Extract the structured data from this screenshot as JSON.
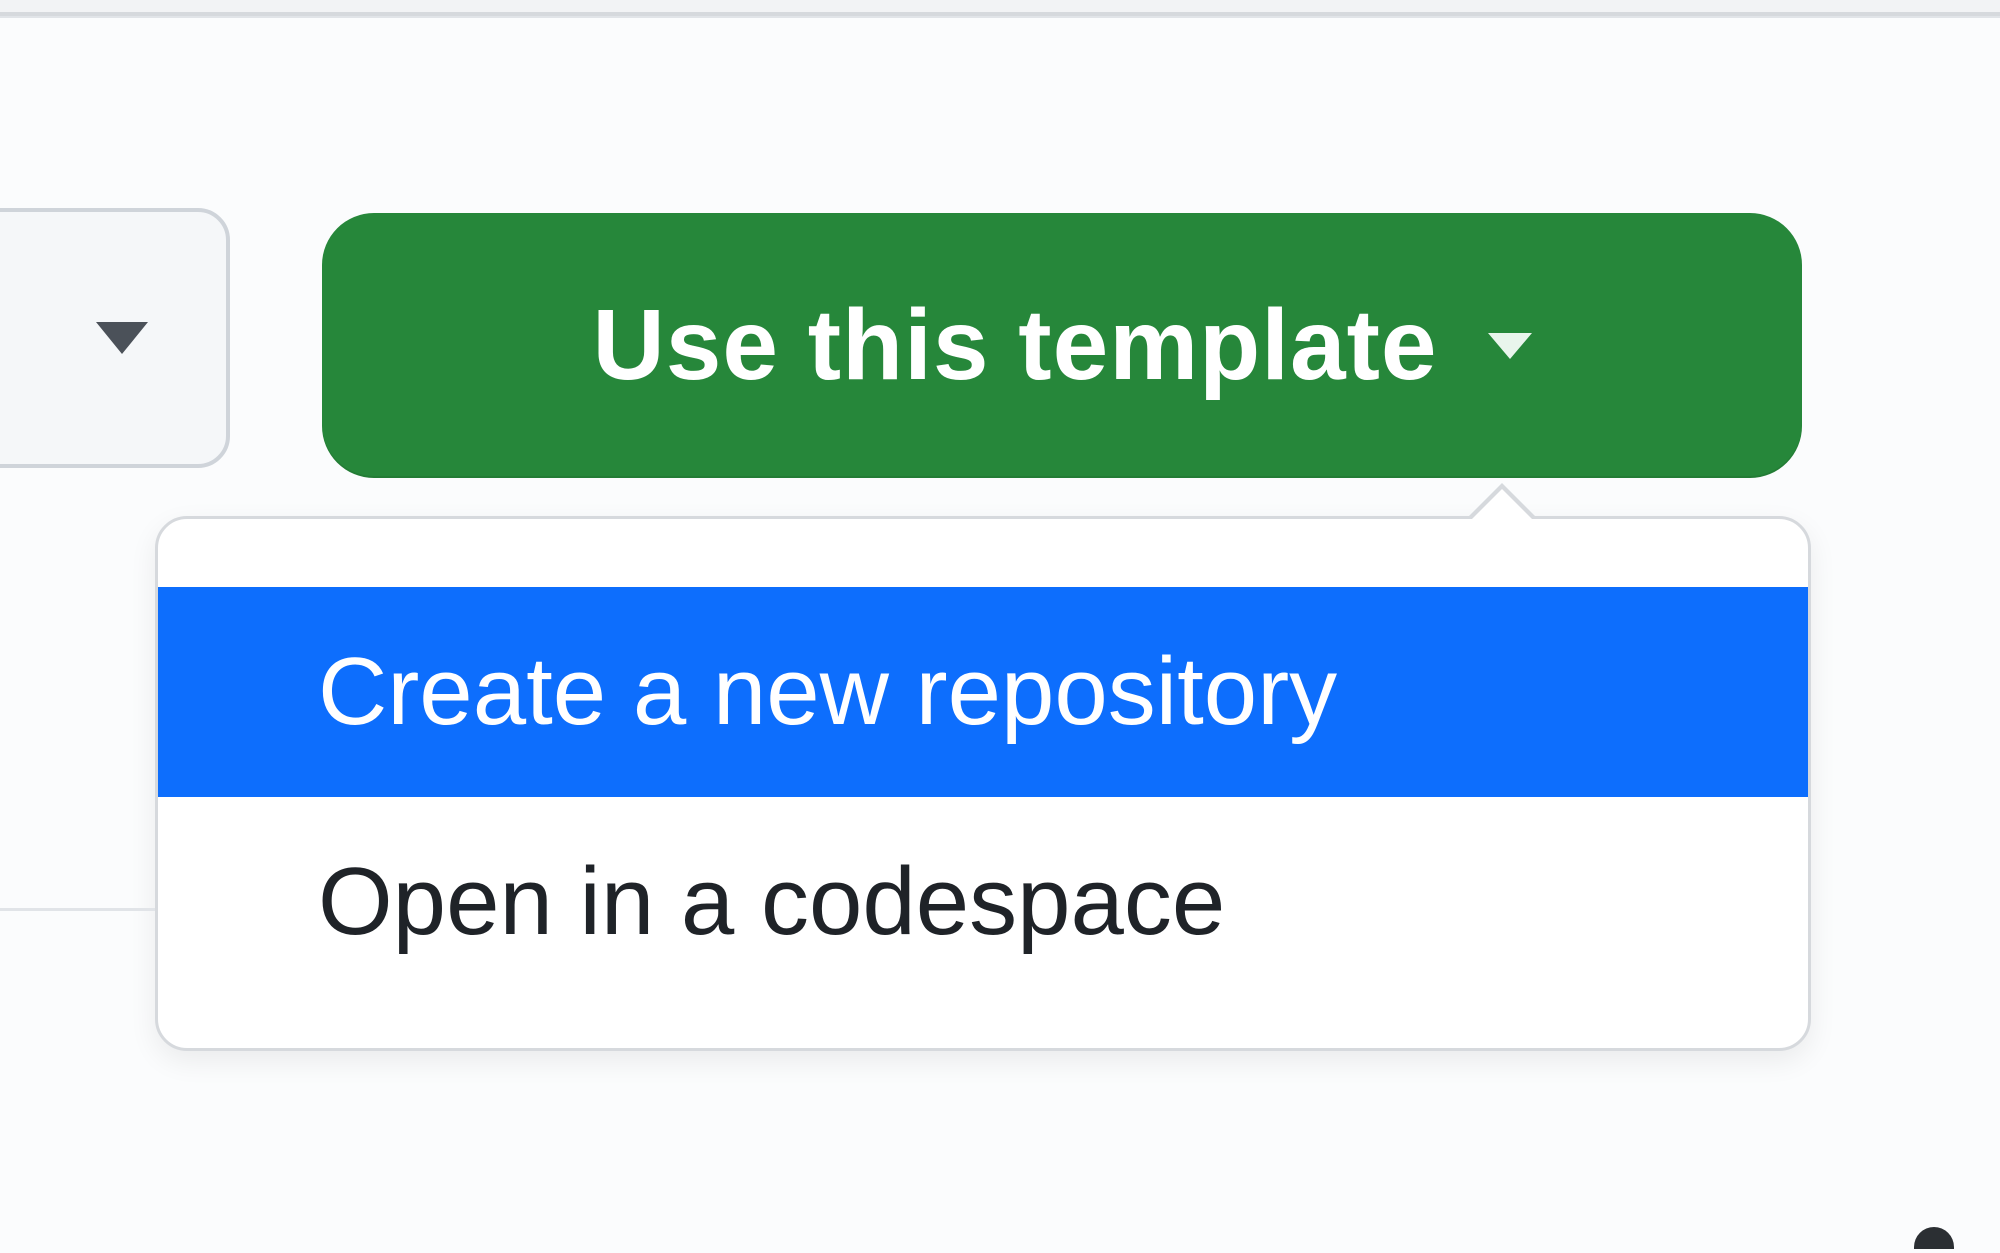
{
  "colors": {
    "primary_button_bg": "#26873a",
    "primary_button_text": "#ffffff",
    "menu_selected_bg": "#0d6efd",
    "menu_selected_text": "#ffffff",
    "menu_text": "#1f2328",
    "border": "#d6d9dd",
    "page_bg": "#fbfcfd"
  },
  "primary_button": {
    "label": "Use this template"
  },
  "dropdown": {
    "items": [
      {
        "label": "Create a new repository",
        "selected": true
      },
      {
        "label": "Open in a codespace",
        "selected": false
      }
    ]
  }
}
